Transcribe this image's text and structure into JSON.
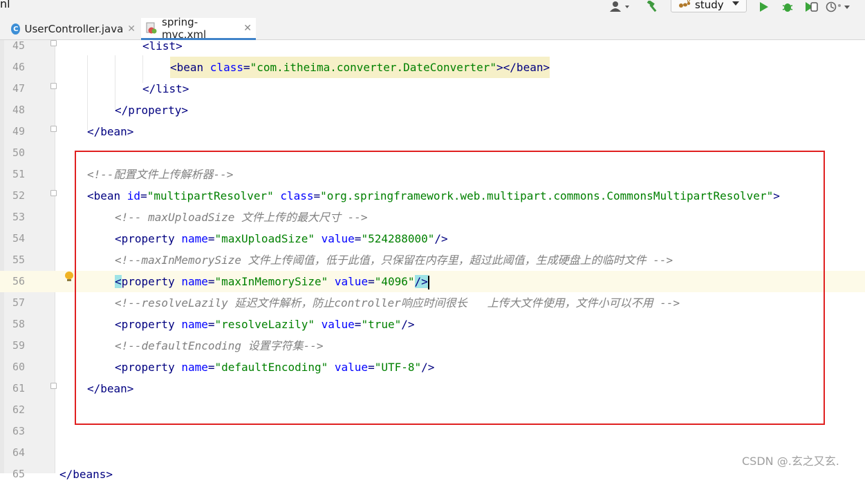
{
  "toolbar": {
    "cut_label": "nl",
    "run_config": "study",
    "icons": [
      "user-icon",
      "hammer-icon",
      "ant-icon",
      "run-icon",
      "debug-icon",
      "coverage-icon",
      "profile-icon"
    ]
  },
  "tabs": [
    {
      "label": "UserController.java",
      "icon": "class-c-icon",
      "active": false
    },
    {
      "label": "spring-mvc.xml",
      "icon": "xml-spring-icon",
      "active": true
    }
  ],
  "editor": {
    "lines": [
      {
        "n": "45",
        "segments": [
          {
            "c": "tag",
            "t": "<list>"
          }
        ],
        "indent": 2
      },
      {
        "n": "46",
        "segments": [
          {
            "c": "tag",
            "t": "<bean "
          },
          {
            "c": "attr",
            "t": "class"
          },
          {
            "c": "tag",
            "t": "="
          },
          {
            "c": "val",
            "t": "\"com.itheima.converter.DateConverter\""
          },
          {
            "c": "tag",
            "t": "></bean>"
          }
        ],
        "indent": 3,
        "highlight": true
      },
      {
        "n": "47",
        "segments": [
          {
            "c": "tag",
            "t": "</list>"
          }
        ],
        "indent": 2
      },
      {
        "n": "48",
        "segments": [
          {
            "c": "tag",
            "t": "</property>"
          }
        ],
        "indent": 1
      },
      {
        "n": "49",
        "segments": [
          {
            "c": "tag",
            "t": "</bean>"
          }
        ],
        "indent": 0
      },
      {
        "n": "50",
        "segments": [],
        "indent": 0
      },
      {
        "n": "51",
        "segments": [
          {
            "c": "cmt",
            "t": "<!--配置文件上传解析器-->"
          }
        ],
        "indent": 0
      },
      {
        "n": "52",
        "segments": [
          {
            "c": "tag",
            "t": "<bean "
          },
          {
            "c": "attr",
            "t": "id"
          },
          {
            "c": "tag",
            "t": "="
          },
          {
            "c": "val",
            "t": "\"multipartResolver\" "
          },
          {
            "c": "attr",
            "t": "class"
          },
          {
            "c": "tag",
            "t": "="
          },
          {
            "c": "val",
            "t": "\"org.springframework.web.multipart.commons.CommonsMultipartResolver\""
          },
          {
            "c": "tag",
            "t": ">"
          }
        ],
        "indent": 0
      },
      {
        "n": "53",
        "segments": [
          {
            "c": "cmt",
            "t": "<!-- maxUploadSize 文件上传的最大尺寸 -->"
          }
        ],
        "indent": 1
      },
      {
        "n": "54",
        "segments": [
          {
            "c": "tag",
            "t": "<property "
          },
          {
            "c": "attr",
            "t": "name"
          },
          {
            "c": "tag",
            "t": "="
          },
          {
            "c": "val",
            "t": "\"maxUploadSize\" "
          },
          {
            "c": "attr",
            "t": "value"
          },
          {
            "c": "tag",
            "t": "="
          },
          {
            "c": "val",
            "t": "\"524288000\""
          },
          {
            "c": "tag",
            "t": "/>"
          }
        ],
        "indent": 1
      },
      {
        "n": "55",
        "segments": [
          {
            "c": "cmt",
            "t": "<!--maxInMemorySize 文件上传阈值，低于此值，只保留在内存里，超过此阈值，生成硬盘上的临时文件 -->"
          }
        ],
        "indent": 1
      },
      {
        "n": "56",
        "segments": [
          {
            "c": "tag match",
            "t": "<"
          },
          {
            "c": "tag",
            "t": "property "
          },
          {
            "c": "attr",
            "t": "name"
          },
          {
            "c": "tag",
            "t": "="
          },
          {
            "c": "val",
            "t": "\"maxInMemorySize\" "
          },
          {
            "c": "attr",
            "t": "value"
          },
          {
            "c": "tag",
            "t": "="
          },
          {
            "c": "val",
            "t": "\"4096\""
          },
          {
            "c": "tag match",
            "t": "/>"
          }
        ],
        "indent": 1,
        "current": true,
        "caret": true
      },
      {
        "n": "57",
        "segments": [
          {
            "c": "cmt",
            "t": "<!--resolveLazily 延迟文件解析，防止controller响应时间很长   上传大文件使用，文件小可以不用 -->"
          }
        ],
        "indent": 1
      },
      {
        "n": "58",
        "segments": [
          {
            "c": "tag",
            "t": "<property "
          },
          {
            "c": "attr",
            "t": "name"
          },
          {
            "c": "tag",
            "t": "="
          },
          {
            "c": "val",
            "t": "\"resolveLazily\" "
          },
          {
            "c": "attr",
            "t": "value"
          },
          {
            "c": "tag",
            "t": "="
          },
          {
            "c": "val",
            "t": "\"true\""
          },
          {
            "c": "tag",
            "t": "/>"
          }
        ],
        "indent": 1
      },
      {
        "n": "59",
        "segments": [
          {
            "c": "cmt",
            "t": "<!--defaultEncoding 设置字符集-->"
          }
        ],
        "indent": 1
      },
      {
        "n": "60",
        "segments": [
          {
            "c": "tag",
            "t": "<property "
          },
          {
            "c": "attr",
            "t": "name"
          },
          {
            "c": "tag",
            "t": "="
          },
          {
            "c": "val",
            "t": "\"defaultEncoding\" "
          },
          {
            "c": "attr",
            "t": "value"
          },
          {
            "c": "tag",
            "t": "="
          },
          {
            "c": "val",
            "t": "\"UTF-8\""
          },
          {
            "c": "tag",
            "t": "/>"
          }
        ],
        "indent": 1
      },
      {
        "n": "61",
        "segments": [
          {
            "c": "tag",
            "t": "</bean>"
          }
        ],
        "indent": 0
      },
      {
        "n": "62",
        "segments": [],
        "indent": 0
      },
      {
        "n": "63",
        "segments": [],
        "indent": 0
      },
      {
        "n": "64",
        "segments": [],
        "indent": 0
      },
      {
        "n": "65",
        "segments": [
          {
            "c": "tag",
            "t": "</beans>"
          }
        ],
        "indent": -1
      }
    ]
  },
  "watermark": "CSDN @.玄之又玄."
}
